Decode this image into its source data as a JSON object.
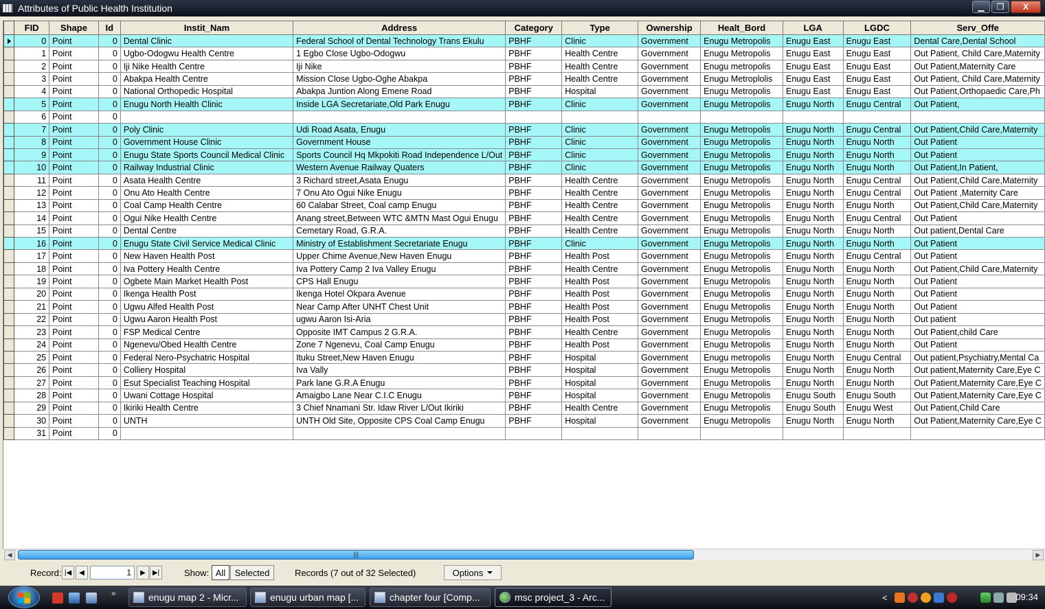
{
  "window": {
    "title": "Attributes of Public Health Institution",
    "minimize": "▁",
    "maximize": "❐",
    "close": "X"
  },
  "table": {
    "columns": [
      "FID",
      "Shape",
      "Id",
      "Instit_Nam",
      "Address",
      "Category",
      "Type",
      "Ownership",
      "Healt_Bord",
      "LGA",
      "LGDC",
      "Serv_Offe"
    ],
    "rows": [
      {
        "sel": true,
        "cells": [
          "0",
          "Point",
          "0",
          "Dental Clinic",
          "Federal School of Dental Technology Trans Ekulu",
          "PBHF",
          "Clinic",
          "Government",
          "Enugu Metropolis",
          "Enugu East",
          "Enugu East",
          "Dental Care,Dental School"
        ]
      },
      {
        "sel": false,
        "cells": [
          "1",
          "Point",
          "0",
          "Ugbo-Odogwu Health Centre",
          "1 Egbo Close Ugbo-Odogwu",
          "PBHF",
          "Health Centre",
          "Government",
          "Enugu Metropolis",
          "Enugu East",
          "Enugu East",
          "Out Patient, Child Care,Maternity"
        ]
      },
      {
        "sel": false,
        "cells": [
          "2",
          "Point",
          "0",
          "Iji Nike Health Centre",
          "Iji Nike",
          "PBHF",
          "Health Centre",
          "Government",
          "Enugu metropolis",
          "Enugu East",
          "Enugu East",
          "Out Patient,Maternity Care"
        ]
      },
      {
        "sel": false,
        "cells": [
          "3",
          "Point",
          "0",
          "Abakpa Health Centre",
          "Mission Close Ugbo-Oghe Abakpa",
          "PBHF",
          "Health Centre",
          "Government",
          "Enugu Metroplolis",
          "Enugu East",
          "Enugu East",
          "Out Patient, Child Care,Maternity"
        ]
      },
      {
        "sel": false,
        "cells": [
          "4",
          "Point",
          "0",
          "National Orthopedic Hospital",
          "Abakpa Juntion Along Emene Road",
          "PBHF",
          "Hospital",
          "Government",
          "Enugu Metropolis",
          "Enugu East",
          "Enugu East",
          "Out Patient,Orthopaedic Care,Ph"
        ]
      },
      {
        "sel": true,
        "cells": [
          "5",
          "Point",
          "0",
          "Enugu North Health Clinic",
          "Inside LGA Secretariate,Old Park Enugu",
          "PBHF",
          "Clinic",
          "Government",
          "Enugu Metropolis",
          "Enugu North",
          "Enugu Central",
          "Out Patient,"
        ]
      },
      {
        "sel": false,
        "cells": [
          "6",
          "Point",
          "0",
          "",
          "",
          "",
          "",
          "",
          "",
          "",
          "",
          ""
        ]
      },
      {
        "sel": true,
        "cells": [
          "7",
          "Point",
          "0",
          "Poly Clinic",
          "Udi Road Asata, Enugu",
          "PBHF",
          "Clinic",
          "Government",
          "Enugu Metropolis",
          "Enugu North",
          "Enugu Central",
          "Out Patient,Child Care,Maternity"
        ]
      },
      {
        "sel": true,
        "cells": [
          "8",
          "Point",
          "0",
          "Government House Clinic",
          "Government House",
          "PBHF",
          "Clinic",
          "Government",
          "Enugu Metropolis",
          "Enugu North",
          "Enugu North",
          "Out Patient"
        ]
      },
      {
        "sel": true,
        "cells": [
          "9",
          "Point",
          "0",
          "Enugu State Sports Council Medical Clinic",
          "Sports Council Hq Mkpokiti Road Independence L/Out",
          "PBHF",
          "Clinic",
          "Government",
          "Enugu Metropolis",
          "Enugu North",
          "Enugu North",
          "Out Patient"
        ]
      },
      {
        "sel": true,
        "cells": [
          "10",
          "Point",
          "0",
          "Railway Industrial Clinic",
          "Western Avenue Railway Quaters",
          "PBHF",
          "Clinic",
          "Government",
          "Enugu Metropolis",
          "Enugu North",
          "Enugu North",
          "Out Patient,In Patient,"
        ]
      },
      {
        "sel": false,
        "cells": [
          "11",
          "Point",
          "0",
          "Asata Health Centre",
          "3 Richard street,Asata Enugu",
          "PBHF",
          "Health Centre",
          "Government",
          "Enugu Metropolis",
          "Enugu North",
          "Enugu Central",
          "Out Patient,Child Care,Maternity"
        ]
      },
      {
        "sel": false,
        "cells": [
          "12",
          "Point",
          "0",
          "Onu Ato Health Centre",
          "7 Onu Ato Ogui Nike Enugu",
          "PBHF",
          "Health Centre",
          "Government",
          "Enugu Metropolis",
          "Enugu North",
          "Enugu Central",
          "Out Patient ,Maternity Care"
        ]
      },
      {
        "sel": false,
        "cells": [
          "13",
          "Point",
          "0",
          "Coal Camp Health Centre",
          "60 Calabar Street, Coal camp Enugu",
          "PBHF",
          "Health Centre",
          "Government",
          "Enugu Metropolis",
          "Enugu North",
          "Enugu North",
          "Out Patient,Child Care,Maternity"
        ]
      },
      {
        "sel": false,
        "cells": [
          "14",
          "Point",
          "0",
          "Ogui Nike Health Centre",
          "Anang street,Between WTC &MTN Mast Ogui Enugu",
          "PBHF",
          "Health Centre",
          "Government",
          "Enugu Metropolis",
          "Enugu North",
          "Enugu Central",
          "Out Patient"
        ]
      },
      {
        "sel": false,
        "cells": [
          "15",
          "Point",
          "0",
          "Dental Centre",
          "Cemetary Road, G.R.A.",
          "PBHF",
          "Health Centre",
          "Government",
          "Enugu Metropolis",
          "Enugu North",
          "Enugu North",
          "Out patient,Dental Care"
        ]
      },
      {
        "sel": true,
        "cells": [
          "16",
          "Point",
          "0",
          "Enugu State Civil Service Medical Clinic",
          "Ministry of Establishment Secretariate Enugu",
          "PBHF",
          "Clinic",
          "Government",
          "Enugu Metropolis",
          "Enugu North",
          "Enugu North",
          "Out Patient"
        ]
      },
      {
        "sel": false,
        "cells": [
          "17",
          "Point",
          "0",
          " New Haven Health Post",
          "Upper Chime Avenue,New Haven Enugu",
          "PBHF",
          "Health Post",
          "Government",
          "Enugu Metropolis",
          "Enugu North",
          "Enugu Central",
          "Out Patient"
        ]
      },
      {
        "sel": false,
        "cells": [
          "18",
          "Point",
          "0",
          " Iva Pottery Health Centre",
          "Iva Pottery Camp 2 Iva Valley Enugu",
          "PBHF",
          "Health Centre",
          "Government",
          "Enugu Metropolis",
          "Enugu North",
          "Enugu North",
          "Out Patient,Child Care,Maternity"
        ]
      },
      {
        "sel": false,
        "cells": [
          "19",
          "Point",
          "0",
          "Ogbete Main Market Health Post",
          "CPS Hall Enugu",
          "PBHF",
          "Health Post",
          "Government",
          "Enugu Metropolis",
          "Enugu North",
          "Enugu North",
          "Out Patient"
        ]
      },
      {
        "sel": false,
        "cells": [
          "20",
          "Point",
          "0",
          "Ikenga Health Post",
          "Ikenga Hotel Okpara Avenue",
          "PBHF",
          "Health Post",
          "Government",
          "Enugu Metropolis",
          "Enugu North",
          "Enugu North",
          "Out Patient"
        ]
      },
      {
        "sel": false,
        "cells": [
          "21",
          "Point",
          "0",
          "Ugwu Alfed Health Post",
          "Near Camp After UNHT Chest Unit",
          "PBHF",
          "Health Post",
          "Government",
          "Enugu Metropolis",
          "Enugu North",
          "Enugu North",
          "Out Patient"
        ]
      },
      {
        "sel": false,
        "cells": [
          "22",
          "Point",
          "0",
          "Ugwu Aaron Health Post",
          "ugwu Aaron Isi-Aria",
          "PBHF",
          "Health Post",
          "Government",
          "Enugu Metropolis",
          "Enugu North",
          "Enugu North",
          "Out patient"
        ]
      },
      {
        "sel": false,
        "cells": [
          "23",
          "Point",
          "0",
          "FSP Medical Centre",
          "Opposite IMT Campus 2 G.R.A.",
          "PBHF",
          "Health Centre",
          "Government",
          "Enugu Metropolis",
          "Enugu North",
          "Enugu North",
          "Out Patient,child Care"
        ]
      },
      {
        "sel": false,
        "cells": [
          "24",
          "Point",
          "0",
          " Ngenevu/Obed Health Centre",
          "Zone 7 Ngenevu, Coal Camp Enugu",
          "PBHF",
          "Health Post",
          "Government",
          "Enugu Metropolis",
          "Enugu North",
          "Enugu North",
          "Out Patient"
        ]
      },
      {
        "sel": false,
        "cells": [
          "25",
          "Point",
          "0",
          "Federal Nero-Psychatric Hospital",
          "Ituku Street,New Haven Enugu",
          "PBHF",
          "Hospital",
          "Government",
          "Enugu metropolis",
          "Enugu North",
          "Enugu Central",
          "Out patient,Psychiatry,Mental Ca"
        ]
      },
      {
        "sel": false,
        "cells": [
          "26",
          "Point",
          "0",
          "Colliery Hospital",
          "Iva Vally",
          "PBHF",
          "Hospital",
          "Government",
          "Enugu Metropolis",
          "Enugu North",
          "Enugu North",
          "Out patient,Maternity Care,Eye C"
        ]
      },
      {
        "sel": false,
        "cells": [
          "27",
          "Point",
          "0",
          " Esut Specialist Teaching Hospital",
          "Park lane G.R.A Enugu",
          "PBHF",
          "Hospital",
          "Government",
          "Enugu Metropolis",
          "Enugu North",
          "Enugu North",
          "Out Patient,Maternity Care,Eye C"
        ]
      },
      {
        "sel": false,
        "cells": [
          "28",
          "Point",
          "0",
          " Uwani Cottage Hospital",
          "Amaigbo Lane Near C.I.C Enugu",
          "PBHF",
          "Hospital",
          "Government",
          "Enugu Metropolis",
          "Enugu South",
          "Enugu South",
          "Out Patient,Maternity Care,Eye C"
        ]
      },
      {
        "sel": false,
        "cells": [
          "29",
          "Point",
          "0",
          "Ikiriki Health Centre",
          "3 Chief Nnamani Str. Idaw River L/Out Ikiriki",
          "PBHF",
          "Health Centre",
          "Government",
          "Enugu Metropolis",
          "Enugu South",
          "Enugu West",
          "Out Patient,Child Care"
        ]
      },
      {
        "sel": false,
        "cells": [
          "30",
          "Point",
          "0",
          " UNTH",
          "UNTH Old Site, Opposite CPS Coal Camp Enugu",
          "PBHF",
          "Hospital",
          "Government",
          "Enugu Metropolis",
          "Enugu North",
          "Enugu North",
          "Out Patient,Maternity Care,Eye C"
        ]
      },
      {
        "sel": false,
        "cells": [
          "31",
          "Point",
          "0",
          "",
          "",
          "",
          "",
          "",
          "",
          "",
          "",
          ""
        ]
      }
    ]
  },
  "statusbar": {
    "record_label": "Record:",
    "record_value": "1",
    "nav_first": "|◀",
    "nav_prev": "◀",
    "nav_next": "▶",
    "nav_last": "▶|",
    "show_label": "Show:",
    "all_label": "All",
    "selected_label": "Selected",
    "records_text": "Records (7 out of 32 Selected)",
    "options_label": "Options"
  },
  "taskbar": {
    "more": "»",
    "tasks": [
      "enugu map 2 - Micr...",
      "enugu urban map [...",
      "chapter four [Comp...",
      "msc project_3 - Arc..."
    ],
    "tray_arrow": "<",
    "clock": "09:34"
  },
  "colors": {
    "selected_row": "#a5f6f6",
    "scroll_thumb": "#3d9ee8"
  }
}
